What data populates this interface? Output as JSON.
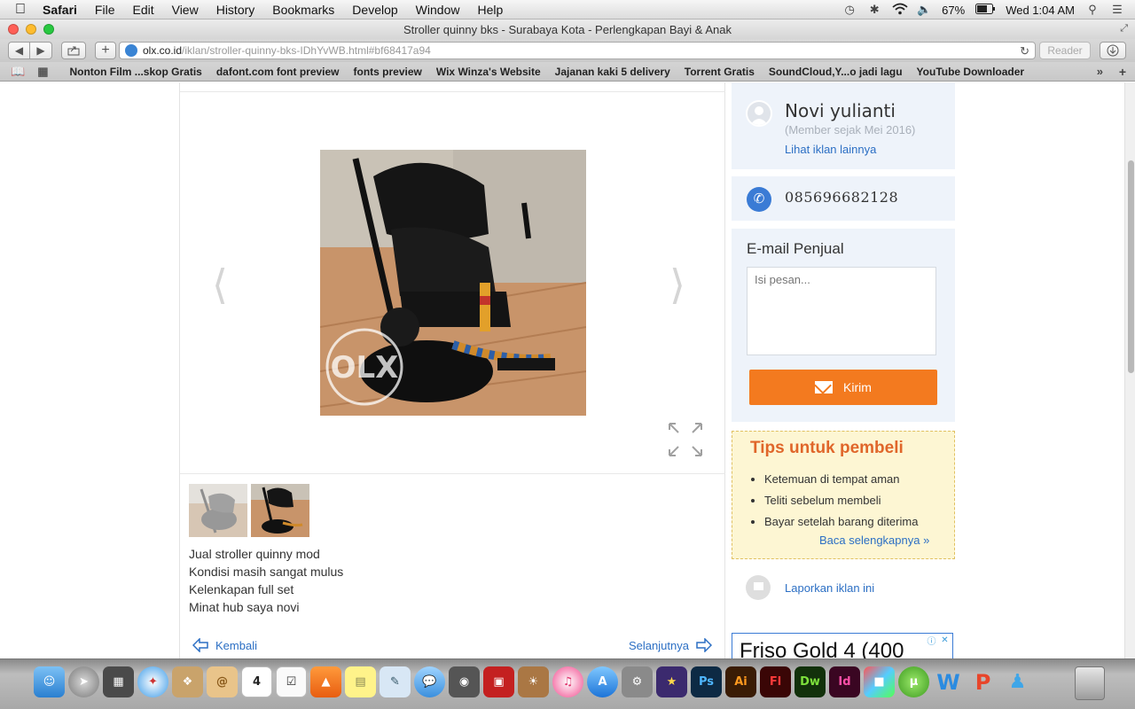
{
  "menubar": {
    "app": "Safari",
    "items": [
      "File",
      "Edit",
      "View",
      "History",
      "Bookmarks",
      "Develop",
      "Window",
      "Help"
    ],
    "battery": "67%",
    "clock": "Wed 1:04 AM"
  },
  "window": {
    "title": "Stroller quinny bks - Surabaya Kota - Perlengkapan Bayi & Anak"
  },
  "toolbar": {
    "url_host": "olx.co.id",
    "url_path": "/iklan/stroller-quinny-bks-IDhYvWB.html#bf68417a94",
    "reader_label": "Reader"
  },
  "bookmarks": [
    "Nonton Film ...skop Gratis",
    "dafont.com font preview",
    "fonts preview",
    "Wix Winza's Website",
    "Jajanan kaki 5 delivery",
    "Torrent Gratis",
    "SoundCloud,Y...o jadi lagu",
    "YouTube Downloader"
  ],
  "listing": {
    "description_lines": [
      "Jual stroller quinny mod",
      "Kondisi masih sangat mulus",
      "Kelenkapan full set",
      "Minat hub saya novi"
    ],
    "back_label": "Kembali",
    "next_label": "Selanjutnya",
    "watermark": "OLX"
  },
  "seller": {
    "name": "Novi yulianti",
    "member_since": "(Member sejak Mei 2016)",
    "other_ads_label": "Lihat iklan lainnya",
    "phone": "085696682128"
  },
  "email_form": {
    "title": "E-mail Penjual",
    "placeholder": "Isi pesan...",
    "send_label": "Kirim"
  },
  "tips": {
    "title": "Tips untuk pembeli",
    "items": [
      "Ketemuan di tempat aman",
      "Teliti sebelum membeli",
      "Bayar setelah barang diterima"
    ],
    "more_label": "Baca selengkapnya »"
  },
  "report_label": "Laporkan iklan ini",
  "ad": {
    "text": "Friso Gold 4 (400"
  },
  "dock": {
    "calendar_day": "4",
    "app_labels": [
      "Ps",
      "Ai",
      "Fl",
      "Dw",
      "Id"
    ]
  },
  "colors": {
    "accent_orange": "#f37a1f",
    "link_blue": "#2c6fc4",
    "panel_bg": "#eef3fa",
    "tips_title": "#e0662a"
  }
}
